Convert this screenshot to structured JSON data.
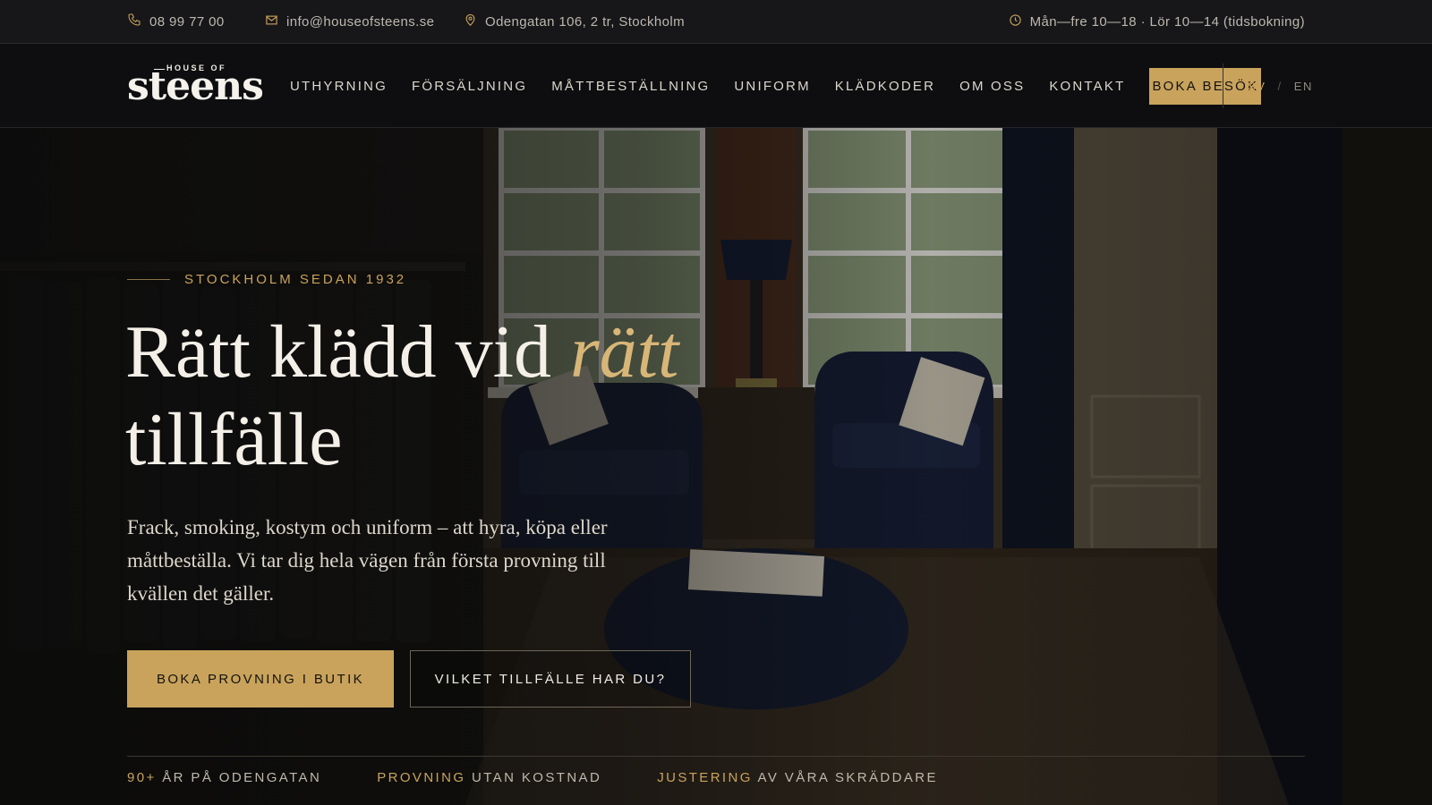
{
  "topbar": {
    "phone": "08 99 77 00",
    "email": "info@houseofsteens.se",
    "address": "Odengatan 106, 2 tr, Stockholm",
    "hours": "Mån—fre 10—18 · Lör 10—14 (tidsbokning)"
  },
  "brand": {
    "small": "HOUSE OF",
    "big": "steens"
  },
  "nav": {
    "items": [
      "UTHYRNING",
      "FÖRSÄLJNING",
      "MÅTTBESTÄLLNING",
      "UNIFORM",
      "KLÄDKODER",
      "OM OSS",
      "KONTAKT"
    ],
    "cta": "BOKA BESÖK"
  },
  "lang": {
    "sv": "SV",
    "sep": "/",
    "en": "EN"
  },
  "hero": {
    "eyebrow": "STOCKHOLM SEDAN 1932",
    "headline_part1": "Rätt klädd vid ",
    "headline_accent": "rätt",
    "headline_part2": "tillfälle",
    "lead": "Frack, smoking, kostym och uniform – att hyra, köpa eller måttbeställa. Vi tar dig hela vägen från första provning till kvällen det gäller.",
    "primary_button": "BOKA PROVNING I BUTIK",
    "secondary_button": "VILKET TILLFÄLLE HAR DU?"
  },
  "stats": [
    {
      "highlight": "90+",
      "text": " ÅR PÅ ODENGATAN"
    },
    {
      "highlight": "PROVNING",
      "text": " UTAN KOSTNAD"
    },
    {
      "highlight": "JUSTERING",
      "text": " AV VÅRA SKRÄDDARE"
    }
  ],
  "colors": {
    "accent": "#c9a35c",
    "background": "#121214",
    "text": "#e8e4dc"
  }
}
